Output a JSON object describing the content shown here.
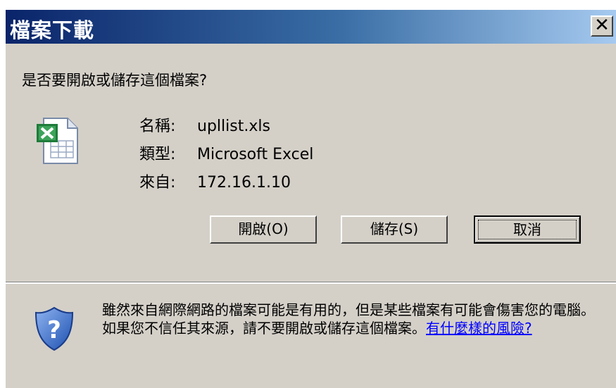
{
  "dialog": {
    "title": "檔案下載",
    "close_label": "✕",
    "question": "是否要開啟或儲存這個檔案?",
    "file": {
      "icon": "excel-file-icon",
      "name_label": "名稱:",
      "name_value": "upllist.xls",
      "type_label": "類型:",
      "type_value": "Microsoft Excel",
      "from_label": "來自:",
      "from_value": "172.16.1.10"
    },
    "buttons": {
      "open": "開啟(O)",
      "save": "儲存(S)",
      "cancel": "取消"
    },
    "warning": {
      "icon": "shield-question-icon",
      "text": "雖然來自網際網路的檔案可能是有用的，但是某些檔案有可能會傷害您的電腦。如果您不信任其來源，請不要開啟或儲存這個檔案。",
      "link": "有什麼樣的風險?"
    }
  },
  "colors": {
    "dialog_bg": "#d4d0c8",
    "title_gradient_start": "#0a246a",
    "title_gradient_end": "#a6caf0",
    "link": "#0000ff"
  }
}
